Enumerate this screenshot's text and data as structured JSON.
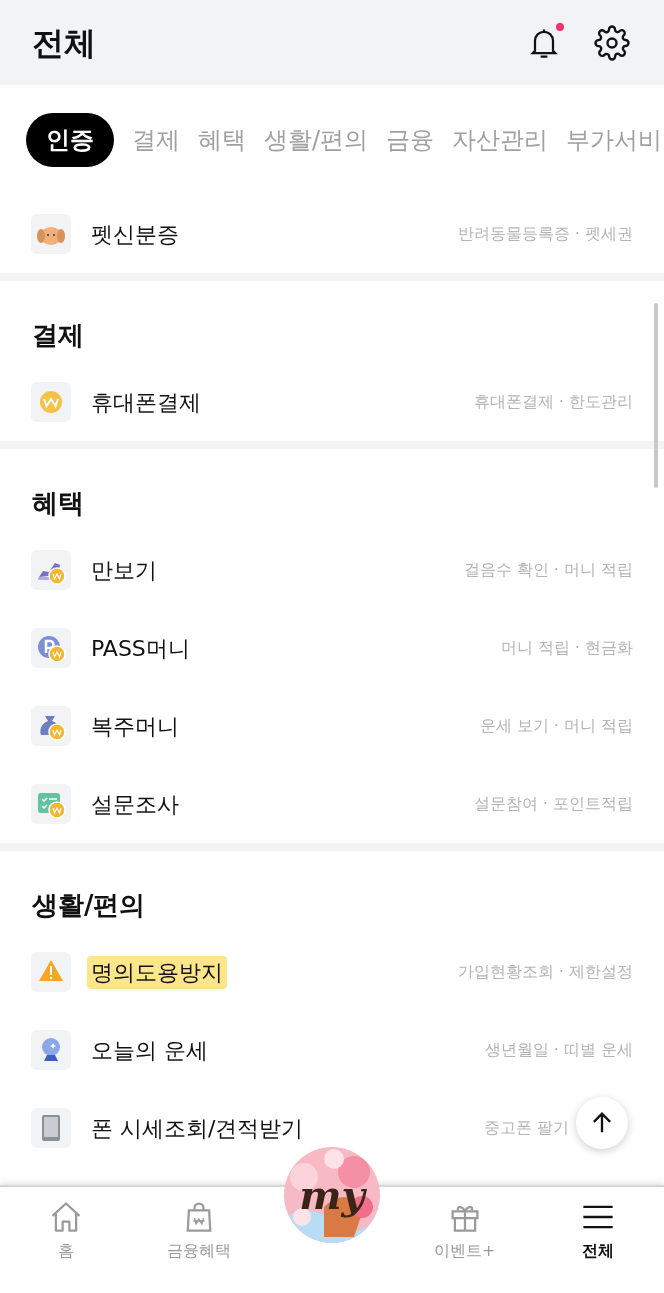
{
  "header": {
    "title": "전체",
    "notification": true
  },
  "tabs": [
    {
      "label": "인증",
      "selected": true
    },
    {
      "label": "결제",
      "selected": false
    },
    {
      "label": "혜택",
      "selected": false
    },
    {
      "label": "생활/편의",
      "selected": false
    },
    {
      "label": "금융",
      "selected": false
    },
    {
      "label": "자산관리",
      "selected": false
    },
    {
      "label": "부가서비",
      "selected": false
    }
  ],
  "sections": [
    {
      "items": [
        {
          "name": "펫신분증",
          "detail": "반려동물등록증 · 펫세권",
          "highlighted": false
        }
      ]
    },
    {
      "title": "결제",
      "items": [
        {
          "name": "휴대폰결제",
          "detail": "휴대폰결제 · 한도관리",
          "highlighted": false
        }
      ]
    },
    {
      "title": "혜택",
      "items": [
        {
          "name": "만보기",
          "detail": "걸음수 확인 · 머니 적립",
          "highlighted": false
        },
        {
          "name": "PASS머니",
          "detail": "머니 적립 · 현금화",
          "highlighted": false
        },
        {
          "name": "복주머니",
          "detail": "운세 보기 · 머니 적립",
          "highlighted": false
        },
        {
          "name": "설문조사",
          "detail": "설문참여 · 포인트적립",
          "highlighted": false
        }
      ]
    },
    {
      "title": "생활/편의",
      "items": [
        {
          "name": "명의도용방지",
          "detail": "가입현황조회 · 제한설정",
          "highlighted": true
        },
        {
          "name": "오늘의 운세",
          "detail": "생년월일 · 띠별 운세",
          "highlighted": false
        },
        {
          "name": "폰 시세조회/견적받기",
          "detail": "중고폰 팔기",
          "highlighted": false
        }
      ]
    }
  ],
  "nav": [
    {
      "kind": "tab",
      "label": "홈",
      "selected": false
    },
    {
      "kind": "tab",
      "label": "금융혜택",
      "selected": false
    },
    {
      "kind": "my",
      "label": "my"
    },
    {
      "kind": "tab",
      "label": "이벤트+",
      "selected": false
    },
    {
      "kind": "tab",
      "label": "전체",
      "selected": true
    }
  ]
}
